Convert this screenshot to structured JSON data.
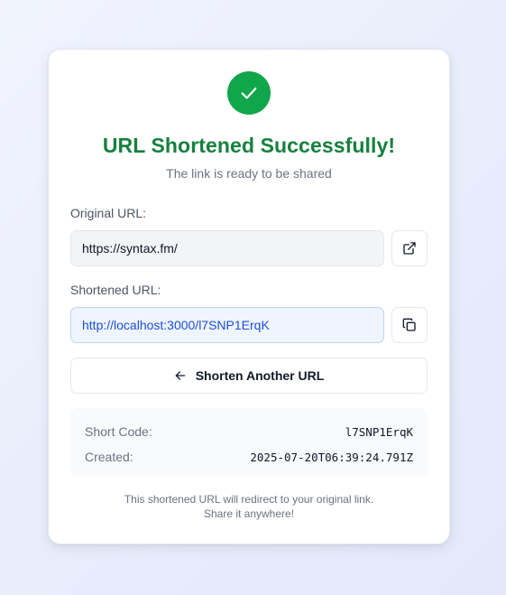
{
  "header": {
    "icon": "check-icon",
    "title": "URL Shortened Successfully!",
    "subtitle": "The link is ready to be shared"
  },
  "original": {
    "label": "Original URL:",
    "value": "https://syntax.fm/",
    "action_icon": "external-link-icon"
  },
  "shortened": {
    "label": "Shortened URL:",
    "value": "http://localhost:3000/l7SNP1ErqK",
    "action_icon": "copy-icon"
  },
  "another_button": {
    "icon": "arrow-left-icon",
    "label": "Shorten Another URL"
  },
  "details": {
    "short_code_label": "Short Code:",
    "short_code_value": "l7SNP1ErqK",
    "created_label": "Created:",
    "created_value": "2025-07-20T06:39:24.791Z"
  },
  "footer": {
    "line1": "This shortened URL will redirect to your original link.",
    "line2": "Share it anywhere!"
  },
  "colors": {
    "success": "#10a64a",
    "title": "#15803d",
    "link": "#1d4ed8"
  }
}
